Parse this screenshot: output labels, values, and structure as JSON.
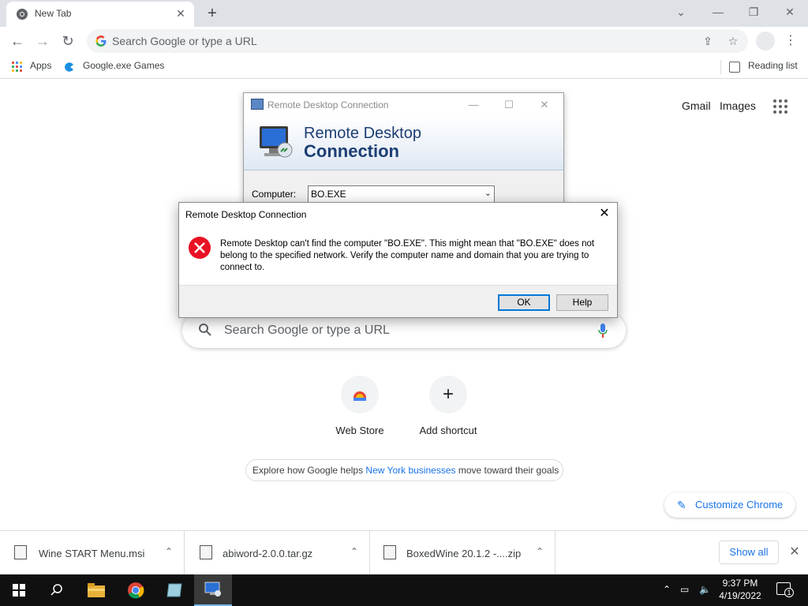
{
  "browser": {
    "tab_title": "New Tab",
    "omnibox_placeholder": "Search Google or type a URL",
    "bookmarks": {
      "apps": "Apps",
      "games": "Google.exe Games",
      "reading_list": "Reading list"
    }
  },
  "ntp": {
    "gmail": "Gmail",
    "images": "Images",
    "search_placeholder": "Search Google or type a URL",
    "shortcuts": [
      {
        "label": "Web Store"
      },
      {
        "label": "Add shortcut"
      }
    ],
    "promo": {
      "before": "Explore how Google helps ",
      "link": "New York businesses",
      "after": " move toward their goals"
    },
    "customize": "Customize Chrome"
  },
  "rdc_window": {
    "title": "Remote Desktop Connection",
    "banner_line1": "Remote Desktop",
    "banner_line2": "Connection",
    "computer_label": "Computer:",
    "computer_value": "BO.EXE"
  },
  "error_dialog": {
    "title": "Remote Desktop Connection",
    "message": "Remote Desktop can't find the computer \"BO.EXE\". This might mean that \"BO.EXE\" does not belong to the specified network.  Verify the computer name and domain that you are trying to connect to.",
    "ok": "OK",
    "help": "Help"
  },
  "downloads": {
    "items": [
      {
        "name": "Wine START Menu.msi"
      },
      {
        "name": "abiword-2.0.0.tar.gz"
      },
      {
        "name": "BoxedWine 20.1.2 -....zip"
      }
    ],
    "show_all": "Show all"
  },
  "taskbar": {
    "time": "9:37 PM",
    "date": "4/19/2022",
    "notification_count": "1"
  },
  "colors": {
    "accent": "#1a73e8",
    "error_red": "#e81123",
    "taskbar": "#101010"
  }
}
